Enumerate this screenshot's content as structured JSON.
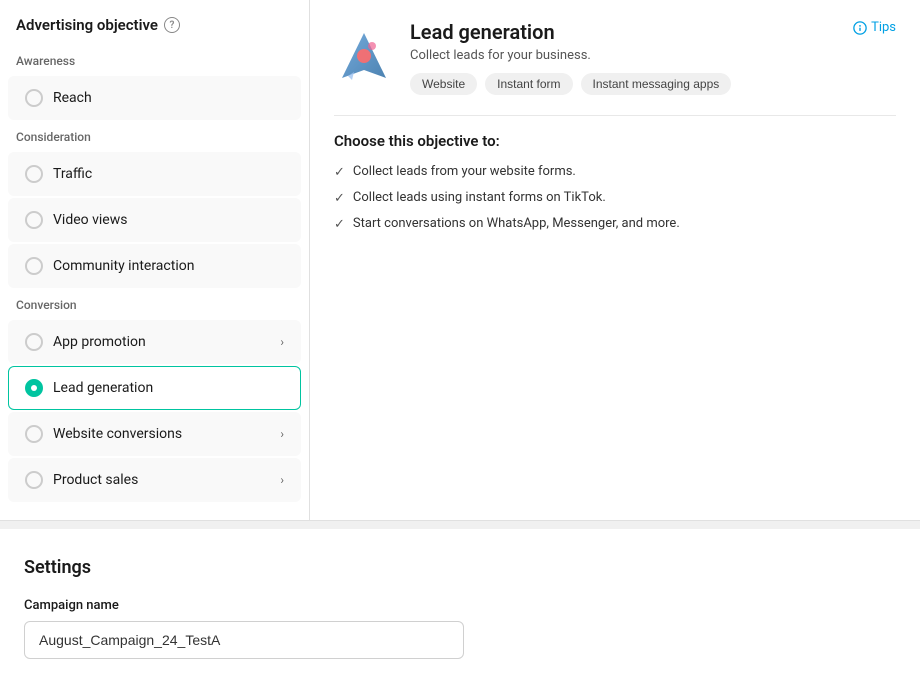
{
  "page": {
    "title": "Advertising objective"
  },
  "left_panel": {
    "title": "Advertising objective",
    "info_icon": "ℹ",
    "sections": [
      {
        "label": "Awareness",
        "items": [
          {
            "id": "reach",
            "label": "Reach",
            "selected": false,
            "has_chevron": false
          }
        ]
      },
      {
        "label": "Consideration",
        "items": [
          {
            "id": "traffic",
            "label": "Traffic",
            "selected": false,
            "has_chevron": false
          },
          {
            "id": "video-views",
            "label": "Video views",
            "selected": false,
            "has_chevron": false
          },
          {
            "id": "community-interaction",
            "label": "Community interaction",
            "selected": false,
            "has_chevron": false
          }
        ]
      },
      {
        "label": "Conversion",
        "items": [
          {
            "id": "app-promotion",
            "label": "App promotion",
            "selected": false,
            "has_chevron": true
          },
          {
            "id": "lead-generation",
            "label": "Lead generation",
            "selected": true,
            "has_chevron": false
          },
          {
            "id": "website-conversions",
            "label": "Website conversions",
            "selected": false,
            "has_chevron": true
          },
          {
            "id": "product-sales",
            "label": "Product sales",
            "selected": false,
            "has_chevron": true
          }
        ]
      }
    ]
  },
  "right_panel": {
    "objective": {
      "title": "Lead generation",
      "description": "Collect leads for your business.",
      "tags": [
        "Website",
        "Instant form",
        "Instant messaging apps"
      ]
    },
    "tips_label": "Tips",
    "choose_title": "Choose this objective to:",
    "checklist": [
      "Collect leads from your website forms.",
      "Collect leads using instant forms on TikTok.",
      "Start conversations on WhatsApp, Messenger, and more."
    ]
  },
  "settings": {
    "title": "Settings",
    "campaign_name_label": "Campaign name",
    "campaign_name_value": "August_Campaign_24_TestA"
  }
}
